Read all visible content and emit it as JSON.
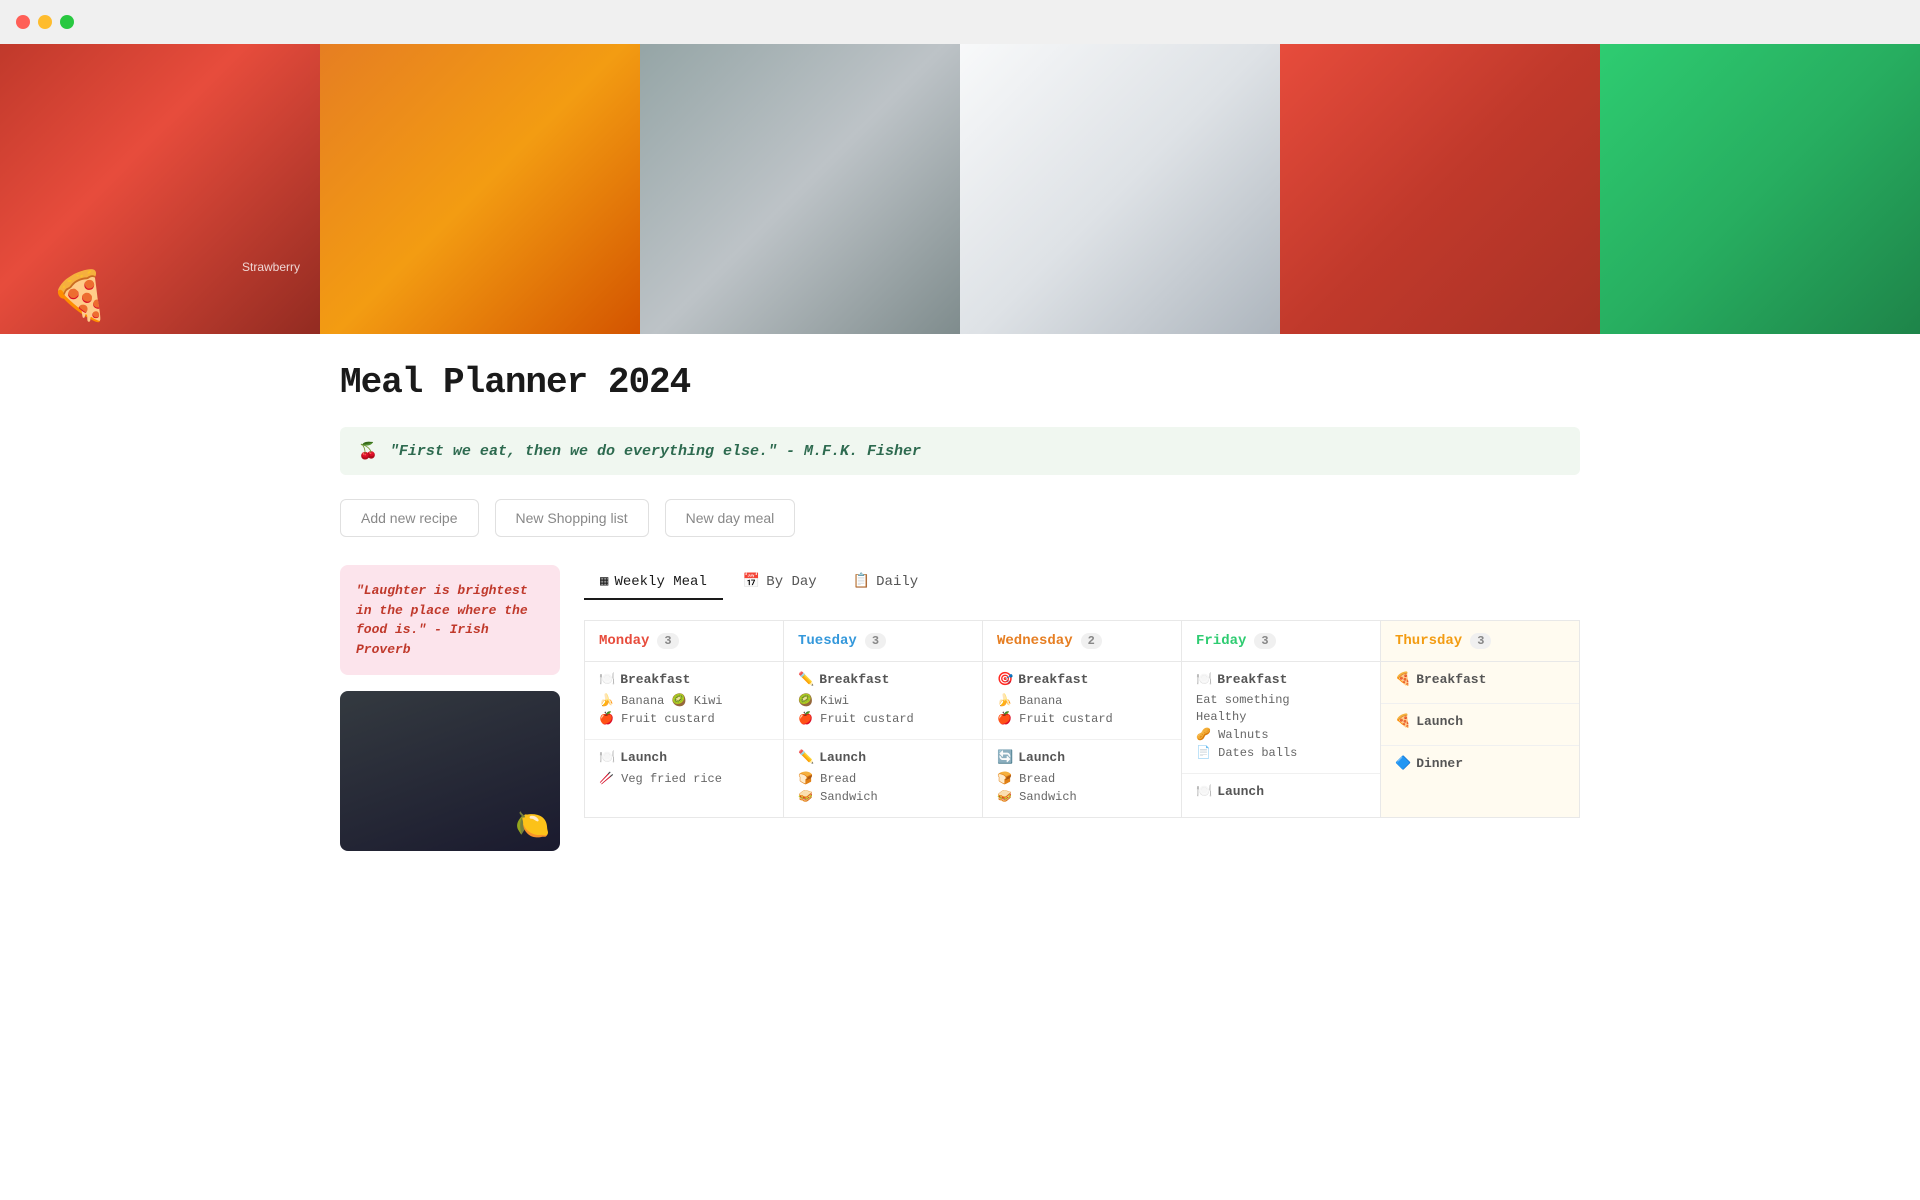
{
  "titlebar": {
    "dots": [
      "red",
      "yellow",
      "green"
    ]
  },
  "hero": {
    "segments": 6
  },
  "page": {
    "title": "Meal Planner 2024",
    "pizza_icon": "🍕"
  },
  "quote": {
    "icon": "🍒",
    "text": "\"First we eat, then we do everything else.\" - M.F.K. Fisher"
  },
  "actions": {
    "add_recipe": "Add new recipe",
    "new_shopping": "New Shopping list",
    "new_day_meal": "New  day meal"
  },
  "sidebar": {
    "quote": "\"Laughter is brightest in the place where the food is.\" - Irish Proverb"
  },
  "tabs": [
    {
      "id": "weekly",
      "icon": "▦",
      "label": "Weekly Meal",
      "active": true
    },
    {
      "id": "byday",
      "icon": "📅",
      "label": "By Day",
      "active": false
    },
    {
      "id": "daily",
      "icon": "📋",
      "label": "Daily",
      "active": false
    }
  ],
  "meal_grid": {
    "columns": [
      {
        "id": "monday",
        "day": "Monday",
        "count": "3",
        "color": "red",
        "sections": [
          {
            "type": "Breakfast",
            "icon": "🍽️",
            "items": [
              "🍌 Banana 🥝 Kiwi",
              "🍎 Fruit custard"
            ]
          },
          {
            "type": "Launch",
            "icon": "🍽️",
            "items": [
              "🥢 Veg fried rice"
            ]
          }
        ]
      },
      {
        "id": "tuesday",
        "day": "Tuesday",
        "count": "3",
        "color": "blue",
        "sections": [
          {
            "type": "Breakfast",
            "icon": "✏️",
            "items": [
              "🥝 Kiwi",
              "🍎 Fruit custard"
            ]
          },
          {
            "type": "Launch",
            "icon": "✏️",
            "items": [
              "🍞 Bread",
              "🥪 Sandwich"
            ]
          }
        ]
      },
      {
        "id": "wednesday",
        "day": "Wednesday",
        "count": "2",
        "color": "orange",
        "sections": [
          {
            "type": "Breakfast",
            "icon": "🎯",
            "items": [
              "🍌 Banana",
              "🍎 Fruit custard"
            ]
          },
          {
            "type": "Launch",
            "icon": "🔄",
            "items": [
              "🍞 Bread",
              "🥪 Sandwich"
            ]
          }
        ]
      },
      {
        "id": "friday",
        "day": "Friday",
        "count": "3",
        "color": "green",
        "sections": [
          {
            "type": "Breakfast",
            "icon": "🍽️",
            "items": [
              "Eat something",
              "Healthy",
              "🥜 Walnuts",
              "📄 Dates balls"
            ]
          },
          {
            "type": "Launch",
            "icon": "🍽️",
            "items": []
          }
        ]
      },
      {
        "id": "thursday",
        "day": "Thursday",
        "count": "3",
        "color": "yellow",
        "sections": [
          {
            "type": "Breakfast",
            "icon": "🍕",
            "items": []
          },
          {
            "type": "Launch",
            "icon": "🍕",
            "items": []
          },
          {
            "type": "Dinner",
            "icon": "🔷",
            "items": []
          }
        ]
      }
    ]
  }
}
